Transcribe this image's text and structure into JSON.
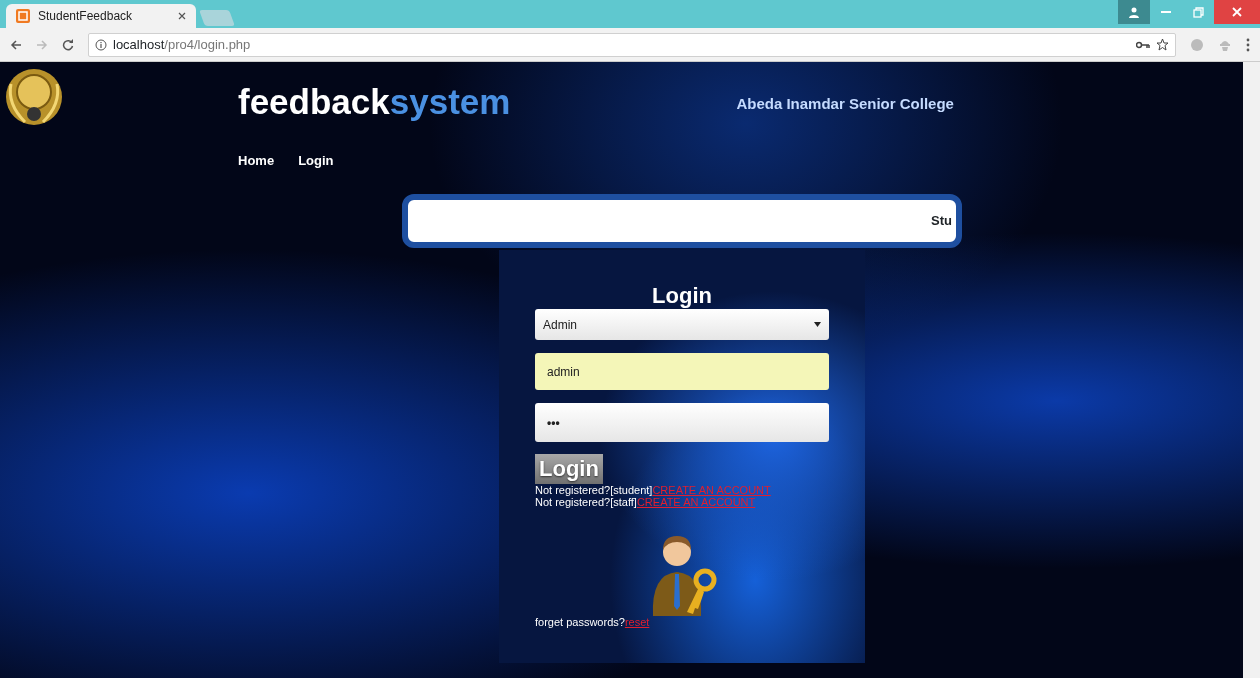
{
  "browser": {
    "tab_title": "StudentFeedback",
    "url_host": "localhost",
    "url_path": "/pro4/login.php"
  },
  "header": {
    "title_main": "feedback",
    "title_accent": "system",
    "college": "Abeda Inamdar Senior College",
    "nav": [
      {
        "label": "Home"
      },
      {
        "label": "Login"
      }
    ]
  },
  "marquee": {
    "text": "Stu"
  },
  "login": {
    "heading": "Login",
    "role_select": {
      "value": "Admin"
    },
    "username": {
      "value": "admin"
    },
    "password": {
      "value": "•••"
    },
    "button": "Login",
    "register_links": [
      {
        "prefix": "Not registered?[student]",
        "link": "CREATE AN ACCOUNT"
      },
      {
        "prefix": "Not registered?[staff]",
        "link": "CREATE AN ACCOUNT"
      }
    ],
    "forgot": {
      "prefix": "forget passwords?",
      "link": "reset"
    }
  }
}
